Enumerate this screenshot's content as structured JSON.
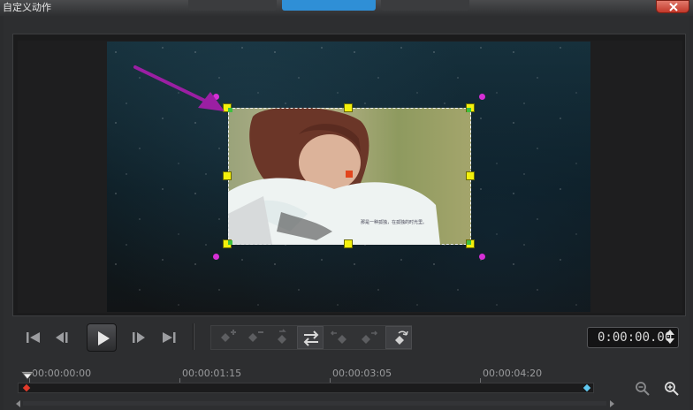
{
  "window": {
    "title": "自定义动作"
  },
  "player": {
    "timecode": "0:00:00.00",
    "controls": [
      "go-to-start",
      "previous-frame",
      "play",
      "next-frame",
      "go-to-end"
    ]
  },
  "toolbar": {
    "tools": [
      "add-keyframe",
      "remove-keyframe",
      "reverse-keyframe",
      "swap-keyframe",
      "move-left",
      "move-right",
      "reset"
    ]
  },
  "timeline": {
    "ticks": [
      "00:00:00:00",
      "00:00:01:15",
      "00:00:03:05",
      "00:00:04:20"
    ],
    "playhead_position": 0.0
  },
  "overlay": {
    "photo_caption": "那是一种孤独，在孤独的时光里。"
  },
  "colors": {
    "handle": "#f4f10c",
    "rotate_handle": "#d62fd6",
    "annotation_arrow": "#9b1fa3",
    "accent_tab": "#2f8fd6"
  }
}
